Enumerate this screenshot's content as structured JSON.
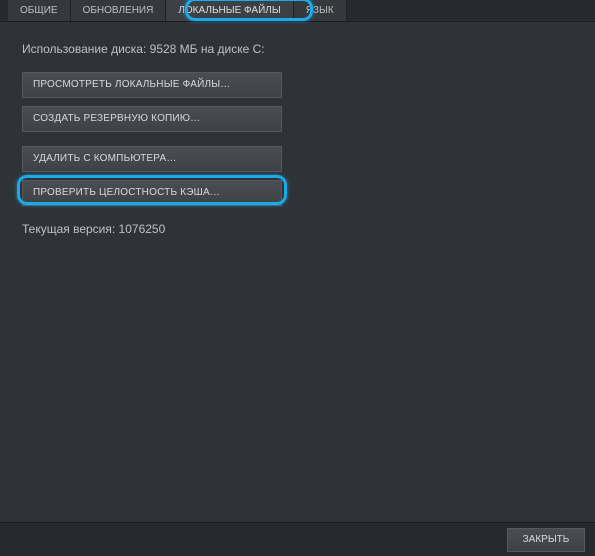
{
  "tabs": {
    "general": "ОБЩИЕ",
    "updates": "ОБНОВЛЕНИЯ",
    "local_files": "ЛОКАЛЬНЫЕ ФАЙЛЫ",
    "language": "ЯЗЫК"
  },
  "disk_usage": "Использование диска: 9528 МБ на диске C:",
  "buttons": {
    "browse": "ПРОСМОТРЕТЬ ЛОКАЛЬНЫЕ ФАЙЛЫ…",
    "backup": "СОЗДАТЬ РЕЗЕРВНУЮ КОПИЮ…",
    "delete": "УДАЛИТЬ С КОМПЬЮТЕРА…",
    "verify": "ПРОВЕРИТЬ ЦЕЛОСТНОСТЬ КЭША…"
  },
  "version": "Текущая версия: 1076250",
  "footer": {
    "close": "ЗАКРЫТЬ"
  },
  "highlight_color": "#1ca9e8"
}
